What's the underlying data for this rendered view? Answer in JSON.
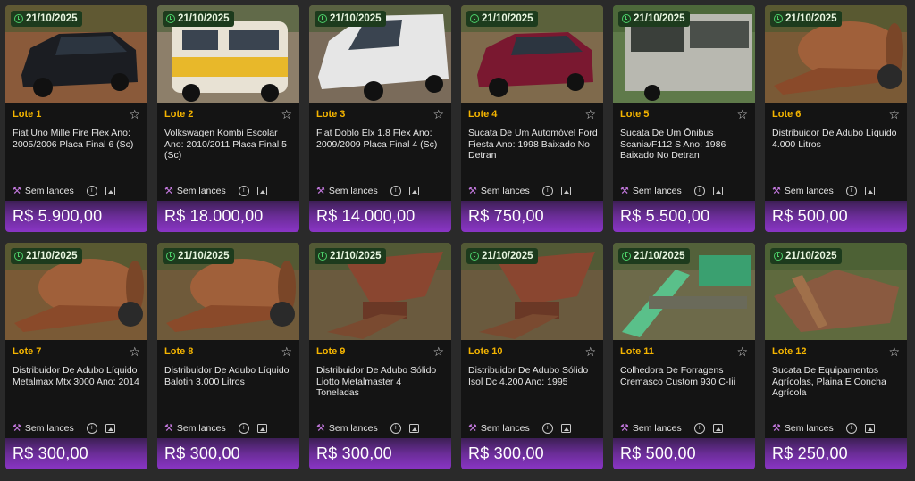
{
  "lots": [
    {
      "date": "21/10/2025",
      "lot": "Lote 1",
      "title": "Fiat Uno Mille Fire Flex Ano: 2005/2006 Placa Final 6 (Sc)",
      "bids": "Sem lances",
      "price": "R$ 5.900,00",
      "thumb": "car-black"
    },
    {
      "date": "21/10/2025",
      "lot": "Lote 2",
      "title": "Volkswagen Kombi Escolar Ano: 2010/2011 Placa Final 5 (Sc)",
      "bids": "Sem lances",
      "price": "R$ 18.000,00",
      "thumb": "van-yellow"
    },
    {
      "date": "21/10/2025",
      "lot": "Lote 3",
      "title": "Fiat Doblo Elx 1.8 Flex Ano: 2009/2009 Placa Final 4 (Sc)",
      "bids": "Sem lances",
      "price": "R$ 14.000,00",
      "thumb": "van-white"
    },
    {
      "date": "21/10/2025",
      "lot": "Lote 4",
      "title": "Sucata De Um Automóvel Ford Fiesta Ano: 1998 Baixado No Detran",
      "bids": "Sem lances",
      "price": "R$ 750,00",
      "thumb": "car-red"
    },
    {
      "date": "21/10/2025",
      "lot": "Lote 5",
      "title": "Sucata De Um Ônibus Scania/F112 S Ano: 1986 Baixado No Detran",
      "bids": "Sem lances",
      "price": "R$ 5.500,00",
      "thumb": "bus"
    },
    {
      "date": "21/10/2025",
      "lot": "Lote 6",
      "title": "Distribuidor De Adubo Líquido 4.000 Litros",
      "bids": "Sem lances",
      "price": "R$ 500,00",
      "thumb": "tank"
    },
    {
      "date": "21/10/2025",
      "lot": "Lote 7",
      "title": "Distribuidor De Adubo Líquido Metalmax Mtx 3000 Ano: 2014",
      "bids": "Sem lances",
      "price": "R$ 300,00",
      "thumb": "tank"
    },
    {
      "date": "21/10/2025",
      "lot": "Lote 8",
      "title": "Distribuidor De Adubo Líquido Balotin 3.000 Litros",
      "bids": "Sem lances",
      "price": "R$ 300,00",
      "thumb": "tank-close"
    },
    {
      "date": "21/10/2025",
      "lot": "Lote 9",
      "title": "Distribuidor De Adubo Sólido Liotto Metalmaster 4 Toneladas",
      "bids": "Sem lances",
      "price": "R$ 300,00",
      "thumb": "hopper"
    },
    {
      "date": "21/10/2025",
      "lot": "Lote 10",
      "title": "Distribuidor De Adubo Sólido Isol Dc 4.200 Ano: 1995",
      "bids": "Sem lances",
      "price": "R$ 300,00",
      "thumb": "hopper"
    },
    {
      "date": "21/10/2025",
      "lot": "Lote 11",
      "title": "Colhedora De Forragens Cremasco Custom 930 C-Iii",
      "bids": "Sem lances",
      "price": "R$ 500,00",
      "thumb": "harvester"
    },
    {
      "date": "21/10/2025",
      "lot": "Lote 12",
      "title": "Sucata De Equipamentos Agrícolas, Plaina E Concha Agrícola",
      "bids": "Sem lances",
      "price": "R$ 250,00",
      "thumb": "scrap"
    }
  ]
}
